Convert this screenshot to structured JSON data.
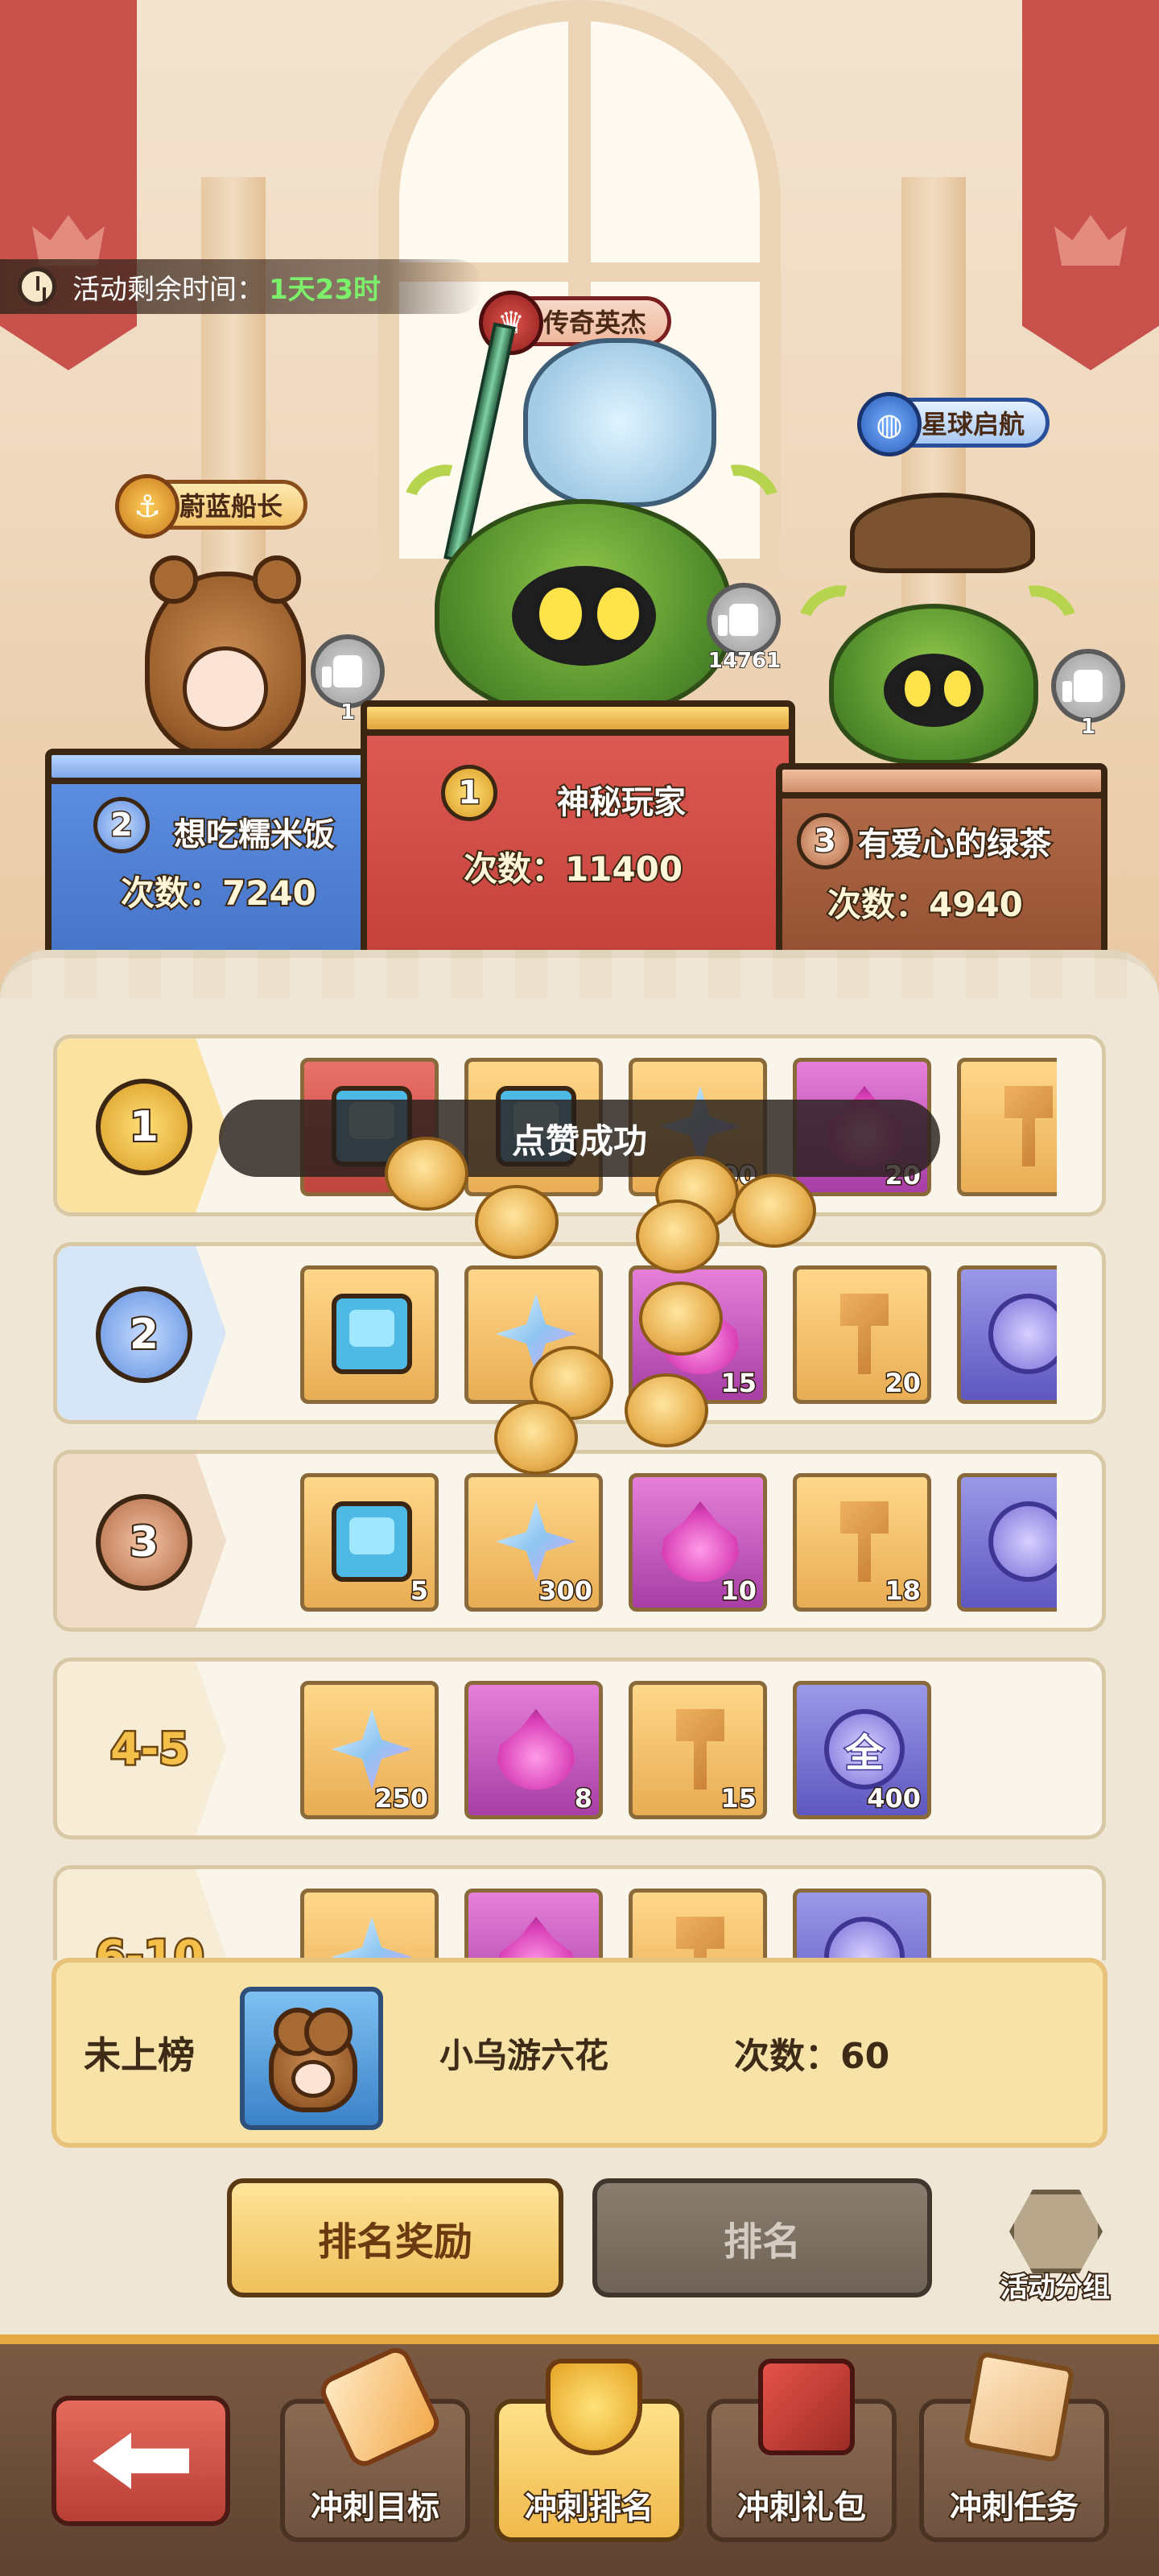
{
  "timer": {
    "label": "活动剩余时间：",
    "value": "1天23时"
  },
  "titles": {
    "first": "传奇英杰",
    "second": "蔚蓝船长",
    "third": "星球启航"
  },
  "podium": [
    {
      "rank": "1",
      "name": "神秘玩家",
      "count": "次数：11400",
      "likes": "14761"
    },
    {
      "rank": "2",
      "name": "想吃糯米饭",
      "count": "次数：7240",
      "likes": "1"
    },
    {
      "rank": "3",
      "name": "有爱心的绿茶",
      "count": "次数：4940",
      "likes": "1"
    }
  ],
  "toast": "点赞成功",
  "reward_rows": [
    {
      "rank": "1",
      "items": [
        {
          "icon": "tv-icon",
          "bg": "red",
          "qty": ""
        },
        {
          "icon": "tv-icon",
          "bg": "gold",
          "qty": ""
        },
        {
          "icon": "crystal-icon",
          "bg": "gold",
          "qty": "400"
        },
        {
          "icon": "flame-icon",
          "bg": "pink",
          "qty": "20"
        },
        {
          "icon": "hammer-icon",
          "bg": "gold",
          "qty": ""
        }
      ]
    },
    {
      "rank": "2",
      "items": [
        {
          "icon": "tv-icon",
          "bg": "gold",
          "qty": ""
        },
        {
          "icon": "crystal-icon",
          "bg": "gold",
          "qty": ""
        },
        {
          "icon": "flame-icon",
          "bg": "pink",
          "qty": "15"
        },
        {
          "icon": "hammer-icon",
          "bg": "gold",
          "qty": "20"
        },
        {
          "icon": "coin-all-icon",
          "bg": "purple",
          "qty": ""
        }
      ]
    },
    {
      "rank": "3",
      "items": [
        {
          "icon": "tv-icon",
          "bg": "gold",
          "qty": "5"
        },
        {
          "icon": "crystal-icon",
          "bg": "gold",
          "qty": "300"
        },
        {
          "icon": "flame-icon",
          "bg": "pink",
          "qty": "10"
        },
        {
          "icon": "hammer-icon",
          "bg": "gold",
          "qty": "18"
        },
        {
          "icon": "coin-all-icon",
          "bg": "purple",
          "qty": ""
        }
      ]
    },
    {
      "rank": "4-5",
      "items": [
        {
          "icon": "crystal-icon",
          "bg": "gold",
          "qty": "250"
        },
        {
          "icon": "flame-icon",
          "bg": "pink",
          "qty": "8"
        },
        {
          "icon": "hammer-icon",
          "bg": "gold",
          "qty": "15"
        },
        {
          "icon": "coin-all-icon",
          "bg": "purple",
          "qty": "400",
          "glyph": "全"
        }
      ]
    },
    {
      "rank": "6-10",
      "items": [
        {
          "icon": "crystal-icon",
          "bg": "gold",
          "qty": ""
        },
        {
          "icon": "flame-icon",
          "bg": "pink",
          "qty": ""
        },
        {
          "icon": "hammer-icon",
          "bg": "gold",
          "qty": ""
        },
        {
          "icon": "coin-all-icon",
          "bg": "purple",
          "qty": ""
        }
      ]
    }
  ],
  "self": {
    "status": "未上榜",
    "name": "小乌游六花",
    "count": "次数：60"
  },
  "tabs": {
    "reward": "排名奖励",
    "ranking": "排名"
  },
  "group_button": "活动分组",
  "nav": [
    "冲刺目标",
    "冲刺排名",
    "冲刺礼包",
    "冲刺任务"
  ],
  "colors": {
    "accent_gold": "#f0c05a",
    "rank1_red": "#c8443d",
    "rank2_blue": "#4f7fd6",
    "rank3_bronze": "#a05a38",
    "timer_green": "#7cf06a"
  }
}
